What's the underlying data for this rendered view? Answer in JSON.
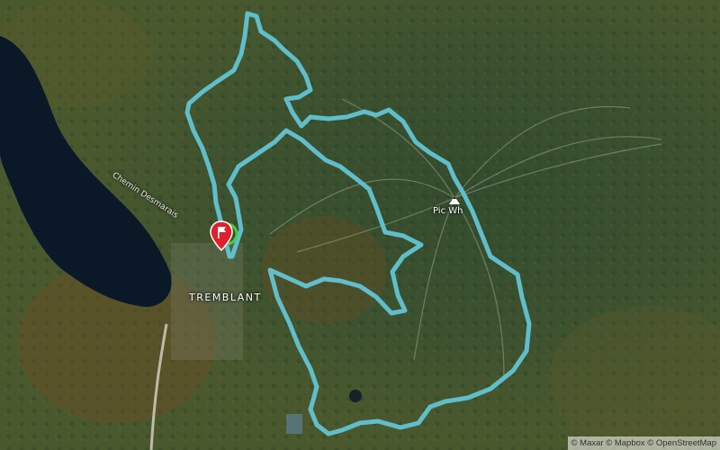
{
  "map": {
    "style": "satellite",
    "route_color": "#62c4d4",
    "water_color": "#0b1828",
    "marker_color": "#e0202c",
    "start_ring_color": "#44d14a"
  },
  "labels": {
    "town": "TREMBLANT",
    "peak": "Pic Wh",
    "road": "Chemin Desmarais"
  },
  "icons": {
    "peak": "mountain-peak-icon",
    "start": "start-flag-marker"
  },
  "attribution": "© Maxar © Mapbox © OpenStreetMap"
}
